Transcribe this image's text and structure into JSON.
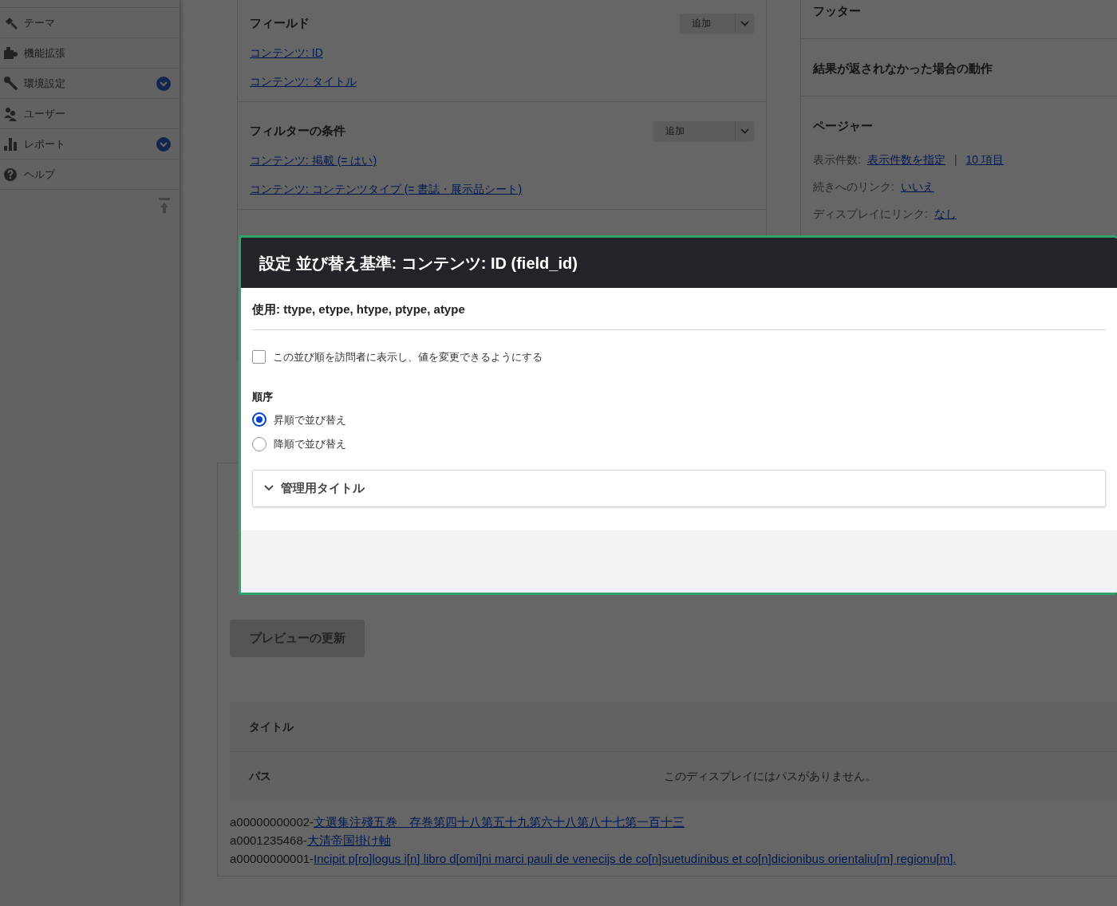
{
  "sidebar": {
    "items": [
      {
        "label": "テーマ",
        "has_submenu": false
      },
      {
        "label": "機能拡張",
        "has_submenu": false
      },
      {
        "label": "環境設定",
        "has_submenu": true
      },
      {
        "label": "ユーザー",
        "has_submenu": false
      },
      {
        "label": "レポート",
        "has_submenu": true
      },
      {
        "label": "ヘルプ",
        "has_submenu": false
      }
    ]
  },
  "fields": {
    "title": "フィールド",
    "add_button": "追加",
    "items": [
      "コンテンツ: ID",
      "コンテンツ: タイトル"
    ]
  },
  "filters": {
    "title": "フィルターの条件",
    "add_button": "追加",
    "items": [
      "コンテンツ: 掲載 (= はい)",
      "コンテンツ: コンテンツタイプ (= 書誌・展示品シート)"
    ]
  },
  "footer": {
    "title": "フッター"
  },
  "no_results": {
    "title": "結果が返されなかった場合の動作"
  },
  "pager": {
    "title": "ページャー",
    "rows": [
      {
        "label": "表示件数:",
        "parts": [
          {
            "kind": "link",
            "text": "表示件数を指定"
          },
          {
            "kind": "separator",
            "text": "|"
          },
          {
            "kind": "link",
            "text": "10 項目"
          }
        ]
      },
      {
        "label": "続きへのリンク:",
        "parts": [
          {
            "kind": "link",
            "text": "いいえ"
          }
        ]
      },
      {
        "label": "ディスプレイにリンク:",
        "parts": [
          {
            "kind": "link",
            "text": "なし"
          }
        ]
      }
    ]
  },
  "modal": {
    "title": "設定 並び替え基準: コンテンツ: ID (field_id)",
    "usage": "使用: ttype, etype, htype, ptype, atype",
    "expose_checkbox": {
      "label": "この並び順を訪問者に表示し、値を変更できるようにする",
      "checked": false
    },
    "order": {
      "label": "順序",
      "options": [
        {
          "label": "昇順で並び替え",
          "selected": true
        },
        {
          "label": "降順で並び替え",
          "selected": false
        }
      ]
    },
    "details": {
      "title": "管理用タイトル",
      "expanded": false
    }
  },
  "preview_button": "プレビューの更新",
  "preview_table": {
    "rows": [
      {
        "label": "タイトル",
        "value": null
      },
      {
        "label": "パス",
        "value": "このディスプレイにはパスがありません。"
      }
    ]
  },
  "results": [
    {
      "prefix": "a00000000002-",
      "title": "文選集注殘五巻　存巻第四十八第五十九第六十八第八十七第一百十三"
    },
    {
      "prefix": "a0001235468-",
      "title": "大清帝国掛け軸"
    },
    {
      "prefix": "a00000000001-",
      "title": "Incipit p[ro]logus i[n] libro d[omi]ni marci pauli de venecijs de co[n]suetudinibus et co[n]dicionibus orientaliu[m] regionu[m]."
    }
  ]
}
